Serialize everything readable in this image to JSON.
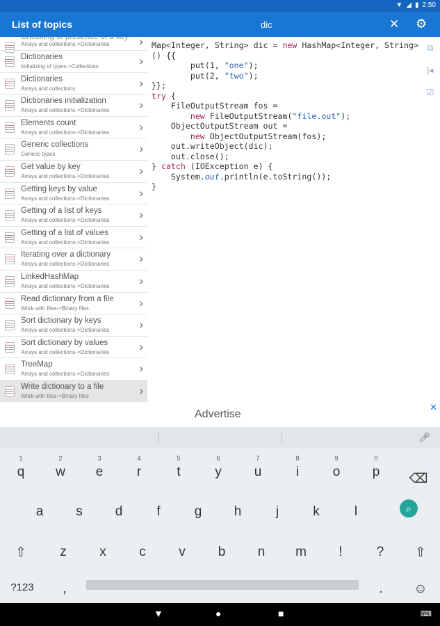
{
  "status": {
    "time": "2:50"
  },
  "appbar": {
    "title": "List of topics",
    "search": "dic"
  },
  "topics": [
    {
      "title": "Checking of presence of a key",
      "subtitle": "Arrays and collections->Dictionaries"
    },
    {
      "title": "Dictionaries",
      "subtitle": "Initializing of types->Collections"
    },
    {
      "title": "Dictionaries",
      "subtitle": "Arrays and collections"
    },
    {
      "title": "Dictionaries initialization",
      "subtitle": "Arrays and collections->Dictionaries"
    },
    {
      "title": "Elements count",
      "subtitle": "Arrays and collections->Dictionaries"
    },
    {
      "title": "Generic collections",
      "subtitle": "Generic types"
    },
    {
      "title": "Get value by key",
      "subtitle": "Arrays and collections->Dictionaries"
    },
    {
      "title": "Getting keys by value",
      "subtitle": "Arrays and collections->Dictionaries"
    },
    {
      "title": "Getting of a list of keys",
      "subtitle": "Arrays and collections->Dictionaries"
    },
    {
      "title": "Getting of a list of values",
      "subtitle": "Arrays and collections->Dictionaries"
    },
    {
      "title": "Iterating over a dictionary",
      "subtitle": "Arrays and collections->Dictionaries"
    },
    {
      "title": "LinkedHashMap",
      "subtitle": "Arrays and collections->Dictionaries"
    },
    {
      "title": "Read dictionary from a file",
      "subtitle": "Work with files->Binary files"
    },
    {
      "title": "Sort dictionary by keys",
      "subtitle": "Arrays and collections->Dictionaries"
    },
    {
      "title": "Sort dictionary by values",
      "subtitle": "Arrays and collections->Dictionaries"
    },
    {
      "title": "TreeMap",
      "subtitle": "Arrays and collections->Dictionaries"
    },
    {
      "title": "Write dictionary to a file",
      "subtitle": "Work with files->Binary files"
    }
  ],
  "code": {
    "l1a": "Map<Integer, String> dic = ",
    "l1kw": "new",
    "l1b": " HashMap<Integer, String>",
    "l2": "() {{",
    "l3a": "        put(1, ",
    "l3s": "\"one\"",
    "l3b": ");",
    "l4a": "        put(2, ",
    "l4s": "\"two\"",
    "l4b": ");",
    "l5": "}};",
    "l6kw": "try",
    "l6b": " {",
    "l7": "    FileOutputStream fos =",
    "l8a": "        ",
    "l8kw": "new",
    "l8b": " FileOutputStream(",
    "l8s": "\"file.out\"",
    "l8c": ");",
    "l9": "    ObjectOutputStream out =",
    "l10a": "        ",
    "l10kw": "new",
    "l10b": " ObjectOutputStream(fos);",
    "l11": "    out.writeObject(dic);",
    "l12": "    out.close();",
    "l13a": "} ",
    "l13kw": "catch",
    "l13b": " (IOException e) {",
    "l14a": "    System.",
    "l14it": "out",
    "l14b": ".println(e.toString());",
    "l15": "}"
  },
  "ad": {
    "label": "Advertise"
  },
  "keyboard": {
    "row1": [
      [
        "q",
        "1"
      ],
      [
        "w",
        "2"
      ],
      [
        "e",
        "3"
      ],
      [
        "r",
        "4"
      ],
      [
        "t",
        "5"
      ],
      [
        "y",
        "6"
      ],
      [
        "u",
        "7"
      ],
      [
        "i",
        "8"
      ],
      [
        "o",
        "9"
      ],
      [
        "p",
        "0"
      ]
    ],
    "row2": [
      "a",
      "s",
      "d",
      "f",
      "g",
      "h",
      "j",
      "k",
      "l"
    ],
    "row3": [
      "z",
      "x",
      "c",
      "v",
      "b",
      "n",
      "m",
      "!",
      "?"
    ],
    "symbols_label": "?123",
    "comma": ",",
    "period": "."
  }
}
